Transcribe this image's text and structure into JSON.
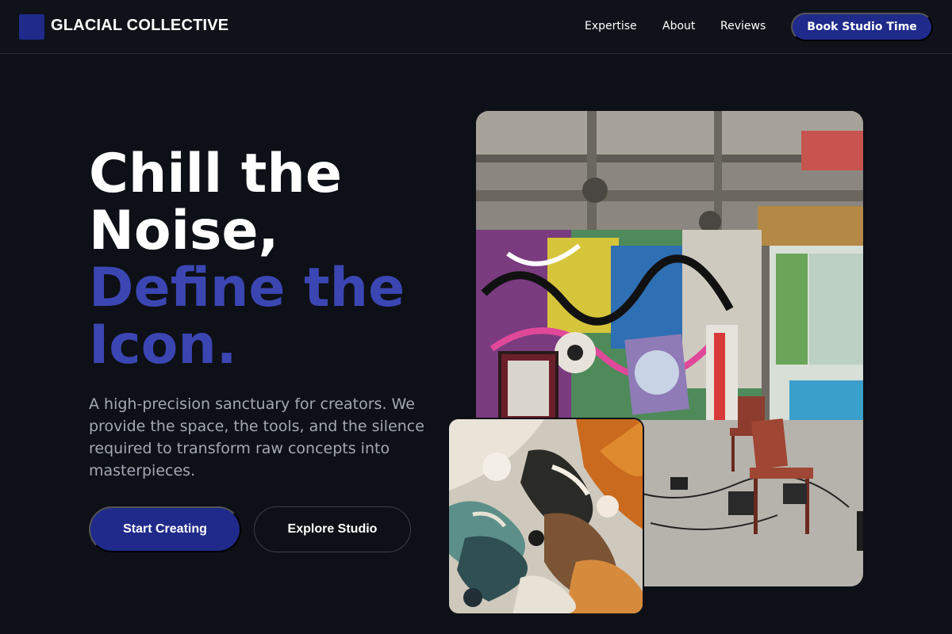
{
  "brand": {
    "name": "GLACIAL COLLECTIVE",
    "color": "#1f2a8a"
  },
  "nav": {
    "links": [
      "Expertise",
      "About",
      "Reviews"
    ],
    "cta": "Book Studio Time"
  },
  "hero": {
    "headline_line1": "Chill the",
    "headline_line2": "Noise,",
    "headline_accent1": "Define the",
    "headline_accent2": "Icon.",
    "accent_color": "#3b46b3",
    "description": "A high-precision sanctuary for creators. We provide the space, the tools, and the silence required to transform raw concepts into masterpieces.",
    "primary_button": "Start Creating",
    "secondary_button": "Explore Studio"
  },
  "images": {
    "studio": "graffiti-art-studio-photo",
    "paint": "oil-paint-texture-closeup-photo"
  }
}
